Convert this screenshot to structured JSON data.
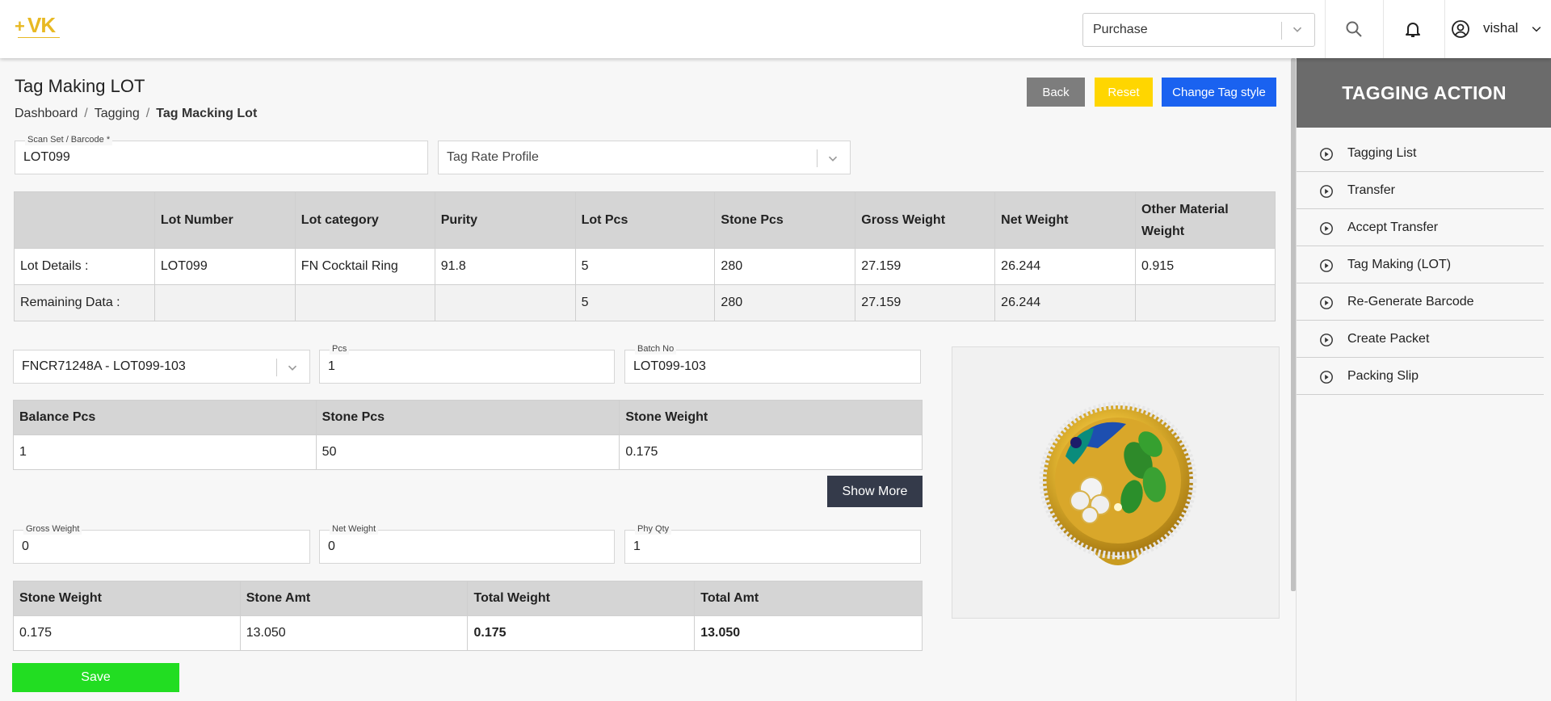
{
  "header": {
    "logo_text": "VK",
    "purchase_select": "Purchase",
    "user_name": "vishal"
  },
  "page": {
    "title": "Tag Making LOT",
    "breadcrumb": [
      "Dashboard",
      "Tagging",
      "Tag Macking Lot"
    ]
  },
  "actions": {
    "back": "Back",
    "reset": "Reset",
    "change_tag_style": "Change Tag style"
  },
  "scan_field": {
    "label": "Scan Set / Barcode *",
    "value": "LOT099"
  },
  "tag_rate_profile": {
    "placeholder": "Tag Rate Profile"
  },
  "lot_table": {
    "headers": [
      "",
      "Lot Number",
      "Lot category",
      "Purity",
      "Lot Pcs",
      "Stone Pcs",
      "Gross Weight",
      "Net Weight",
      "Other Material Weight"
    ],
    "rows": [
      [
        "Lot Details :",
        "LOT099",
        "FN Cocktail Ring",
        "91.8",
        "5",
        "280",
        "27.159",
        "26.244",
        "0.915"
      ],
      [
        "Remaining Data :",
        "",
        "",
        "",
        "5",
        "280",
        "27.159",
        "26.244",
        ""
      ]
    ]
  },
  "design_select": {
    "value": "FNCR71248A - LOT099-103"
  },
  "pcs_field": {
    "label": "Pcs",
    "value": "1"
  },
  "batch_field": {
    "label": "Batch No",
    "value": "LOT099-103"
  },
  "balance_table": {
    "headers": [
      "Balance Pcs",
      "Stone Pcs",
      "Stone Weight"
    ],
    "row": [
      "1",
      "50",
      "0.175"
    ]
  },
  "show_more": "Show More",
  "gross_field": {
    "label": "Gross Weight",
    "value": "0"
  },
  "net_field": {
    "label": "Net Weight",
    "value": "0"
  },
  "phy_field": {
    "label": "Phy Qty",
    "value": "1"
  },
  "totals_table": {
    "headers": [
      "Stone Weight",
      "Stone Amt",
      "Total Weight",
      "Total Amt"
    ],
    "row": [
      "0.175",
      "13.050",
      "0.175",
      "13.050"
    ]
  },
  "save": "Save",
  "panel": {
    "title": "TAGGING ACTION",
    "items": [
      "Tagging List",
      "Transfer",
      "Accept Transfer",
      "Tag Making (LOT)",
      "Re-Generate Barcode",
      "Create Packet",
      "Packing Slip"
    ]
  },
  "colors": {
    "back": "#7d7d7d",
    "reset": "#ffd600",
    "change_tag_style": "#1a62f0",
    "show_more": "#343a4a",
    "save": "#22dd22",
    "panel_header": "#6b6b6b",
    "logo": "#e8b923"
  }
}
